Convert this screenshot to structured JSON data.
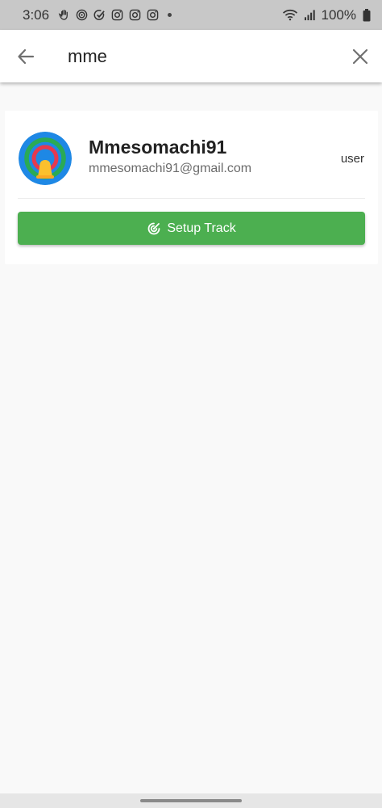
{
  "status_bar": {
    "time": "3:06",
    "battery": "100%",
    "icons": [
      "hand-icon",
      "signal-rings-icon",
      "check-icon",
      "instagram-icon",
      "instagram-icon",
      "instagram-icon",
      "notification-dot",
      "wifi-icon",
      "cell-signal-icon",
      "battery-icon"
    ]
  },
  "search": {
    "query": "mme",
    "back_icon": "arrow-left-icon",
    "close_icon": "close-icon"
  },
  "result": {
    "name": "Mmesomachi91",
    "email": "mmesomachi91@gmail.com",
    "role": "user",
    "avatar_icon": "radar-bell-icon",
    "button_label": "Setup Track",
    "button_icon": "track-icon",
    "button_color": "#4caf50"
  },
  "colors": {
    "status_bar": "#c8c8c8",
    "background": "#f9f9f9",
    "accent": "#4caf50"
  }
}
